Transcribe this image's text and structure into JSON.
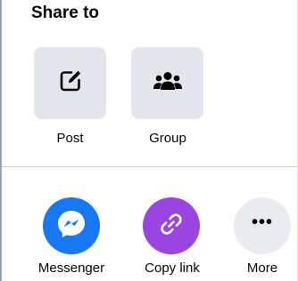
{
  "share_sheet": {
    "title": "Share to",
    "primary_options": [
      {
        "label": "Post",
        "icon": "compose-icon"
      },
      {
        "label": "Group",
        "icon": "group-icon"
      }
    ],
    "secondary_options": [
      {
        "label": "Messenger",
        "icon": "messenger-icon",
        "color": "#1877f2"
      },
      {
        "label": "Copy link",
        "icon": "link-icon",
        "color": "#9b45e0"
      },
      {
        "label": "More",
        "icon": "more-icon",
        "symbol": "•••",
        "color": "#e9ebee"
      }
    ]
  }
}
